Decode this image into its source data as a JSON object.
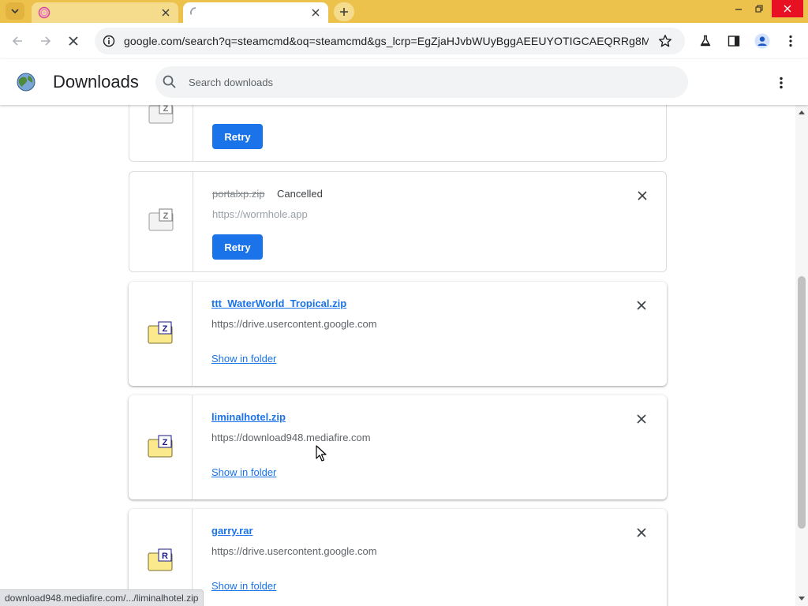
{
  "colors": {
    "tabstrip": "#edc24c",
    "accent": "#1a73e8",
    "close_button": "#e81123",
    "header_shadow": "#dadce0"
  },
  "browser": {
    "tabs": [
      {
        "title": "",
        "favicon": "wormhole-favicon",
        "active": false
      },
      {
        "title": "",
        "favicon": "loading-spinner-icon",
        "active": true
      }
    ],
    "new_tab_icon": "plus-icon",
    "address_bar": {
      "url": "google.com/search?q=steamcmd&oq=steamcmd&gs_lcrp=EgZjaHJvbWUyBggAEEUYOTIGCAEQRRg8MgYI..."
    }
  },
  "downloads": {
    "title": "Downloads",
    "search_placeholder": "Search downloads",
    "items": [
      {
        "file_name": "",
        "status": "",
        "source": "",
        "action_label": "Retry",
        "state": "cancelled",
        "file_type": "Z"
      },
      {
        "file_name": "portalxp.zip",
        "status": "Cancelled",
        "source": "https://wormhole.app",
        "action_label": "Retry",
        "state": "cancelled",
        "file_type": "Z"
      },
      {
        "file_name": "ttt_WaterWorld_Tropical.zip",
        "status": "",
        "source": "https://drive.usercontent.google.com",
        "action_label": "Show in folder",
        "state": "complete",
        "file_type": "Z"
      },
      {
        "file_name": "liminalhotel.zip",
        "status": "",
        "source": "https://download948.mediafire.com",
        "action_label": "Show in folder",
        "state": "complete",
        "file_type": "Z"
      },
      {
        "file_name": "garry.rar",
        "status": "",
        "source": "https://drive.usercontent.google.com",
        "action_label": "Show in folder",
        "state": "complete",
        "file_type": "R"
      }
    ]
  },
  "status_bar": {
    "text": "download948.mediafire.com/.../liminalhotel.zip"
  }
}
